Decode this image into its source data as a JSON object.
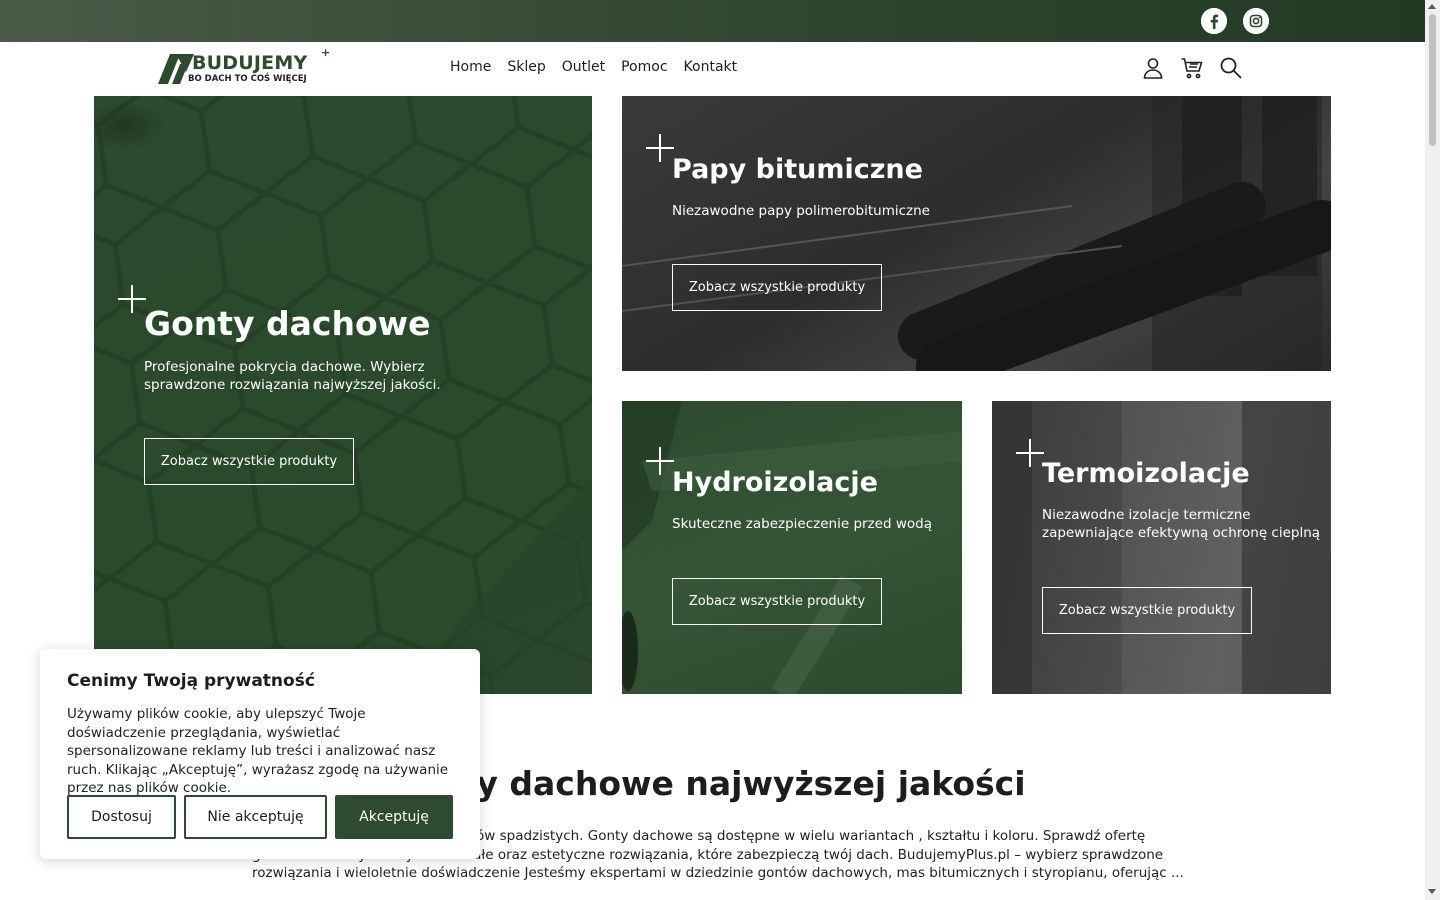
{
  "topbar": {
    "social": [
      {
        "icon": "facebook-icon"
      },
      {
        "icon": "instagram-icon"
      }
    ]
  },
  "header": {
    "logo": {
      "brand": "BUDUJEMY",
      "plus": "+",
      "tagline": "BO DACH TO COŚ WIĘCEJ"
    },
    "nav": [
      "Home",
      "Sklep",
      "Outlet",
      "Pomoc",
      "Kontakt"
    ],
    "icons": [
      "user-icon",
      "cart-icon",
      "search-icon"
    ]
  },
  "tiles": {
    "gonty": {
      "title": "Gonty dachowe",
      "description": "Profesjonalne pokrycia dachowe. Wybierz sprawdzone rozwiązania najwyższej jakości.",
      "button": "Zobacz wszystkie produkty"
    },
    "papy": {
      "title": "Papy bitumiczne",
      "description": "Niezawodne papy polimerobitumiczne",
      "button": "Zobacz wszystkie produkty"
    },
    "hydro": {
      "title": "Hydroizolacje",
      "description": "Skuteczne zabezpieczenie przed wodą",
      "button": "Zobacz wszystkie produkty"
    },
    "termo": {
      "title": "Termoizolacje",
      "description": "Niezawodne izolacje termiczne zapewniające efektywną ochronę cieplną",
      "button": "Zobacz wszystkie produkty"
    }
  },
  "article": {
    "title": "onty dachowe najwyższej jakości",
    "body": "wniają długotrwałą ochronę dachów spadzistych. Gonty dachowe są dostępne w wielu wariantach , kształtu i koloru. Sprawdź ofertę gontów dachowych i wybierz trwałe oraz estetyczne rozwiązania, które zabezpieczą twój dach. BudujemyPlus.pl – wybierz sprawdzone rozwiązania i wieloletnie doświadczenie Jesteśmy ekspertami w dziedzinie gontów dachowych, mas bitumicznych i styropianu, oferując ..."
  },
  "cookie": {
    "title": "Cenimy Twoją prywatność",
    "text": "Używamy plików cookie, aby ulepszyć Twoje doświadczenie przeglądania, wyświetlać spersonalizowane reklamy lub treści i analizować nasz ruch. Klikając „Akceptuję”, wyrażasz zgodę na używanie przez nas plików cookie.",
    "buttons": {
      "customize": "Dostosuj",
      "reject": "Nie akceptuję",
      "accept": "Akceptuję"
    }
  },
  "colors": {
    "brand_green": "#2e4a2f",
    "topbar": "#2f4630"
  }
}
